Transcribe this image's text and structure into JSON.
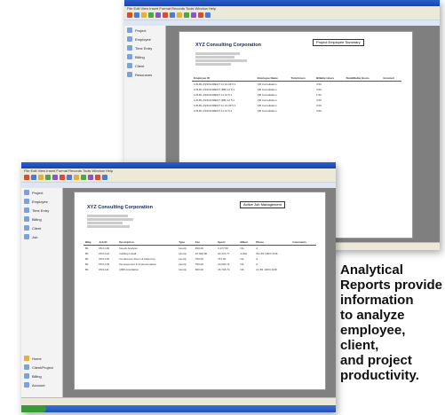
{
  "back_report": {
    "company": "XYZ Consulting Corporation",
    "report_title": "Project Employee Summary",
    "sidebar": [
      "Project",
      "Employee",
      "Time Entry",
      "Billing",
      "Client",
      "Resources"
    ],
    "columns": [
      "Employee ID",
      "Employee Name",
      "Total Hours",
      "Billable Hours",
      "NonBillable Hours",
      "Invoiced"
    ],
    "rows": [
      [
        "A-B-BL ASSIGNMENT 11 10-09 5:1",
        "QB Consultation",
        "",
        "4.50",
        "",
        ""
      ],
      [
        "A-B-BL ASSIGNMENT (BB) 12 5:1",
        "QB Consultation",
        "",
        "4.50",
        "",
        ""
      ],
      [
        "A-B-BL ASSIGNMENT 11 12 5:1",
        "QB Consultation",
        "",
        "1.50",
        "",
        ""
      ],
      [
        "A-B-BL ASSIGNMENT (BB) 12 5:1",
        "QB Consultation",
        "",
        "4.50",
        "",
        ""
      ],
      [
        "A-B-BL ASSIGNMENT 11 10-09 5:1",
        "QB Consultation",
        "",
        "3.00",
        "",
        ""
      ],
      [
        "A-B-BL ASSIGNMENT 11 12 5:1",
        "QB Consultation",
        "",
        "4.50",
        "",
        ""
      ]
    ]
  },
  "front_report": {
    "company": "XYZ Consulting Corporation",
    "report_title": "Active Job Management",
    "sidebar": [
      "Project",
      "Employee",
      "Time Entry",
      "Billing",
      "Client",
      "Job"
    ],
    "sidebar_bottom": [
      "Home",
      "Client/Project",
      "Billing",
      "Account"
    ],
    "columns": [
      "Blkg",
      "Job ID",
      "Description",
      "Type",
      "Fee",
      "Spent",
      "Billed",
      "Phase",
      "Comments"
    ],
    "rows": [
      [
        "B1",
        "PRJ-100",
        "Needs Analysis",
        "Hourly",
        "450.00",
        "4,177.50",
        "NA",
        "A"
      ],
      [
        "B1",
        "PRJ-101",
        "Cabling Install",
        "Hourly",
        "15,000.00",
        "20,474.77",
        "4,000",
        "W1 B1 100% 4/06"
      ],
      [
        "B1",
        "PRJ-102",
        "Conference Room & Data Grp",
        "Hourly",
        "750.00",
        "767.00",
        "NA",
        "A"
      ],
      [
        "B1",
        "PRJ-103",
        "Development & Implementation",
        "Hourly",
        "750.00",
        "10,000.74",
        "NA",
        "A"
      ],
      [
        "B1",
        "PRJ-111",
        "QB/Consultation",
        "Hourly",
        "600.00",
        "15,718.70",
        "NA",
        "A1 B1 100% 4/08"
      ]
    ]
  },
  "caption": {
    "lines": [
      "Analytical",
      "Reports provide",
      "information",
      "to analyze",
      "employee, client,",
      "and project",
      "productivity."
    ]
  }
}
